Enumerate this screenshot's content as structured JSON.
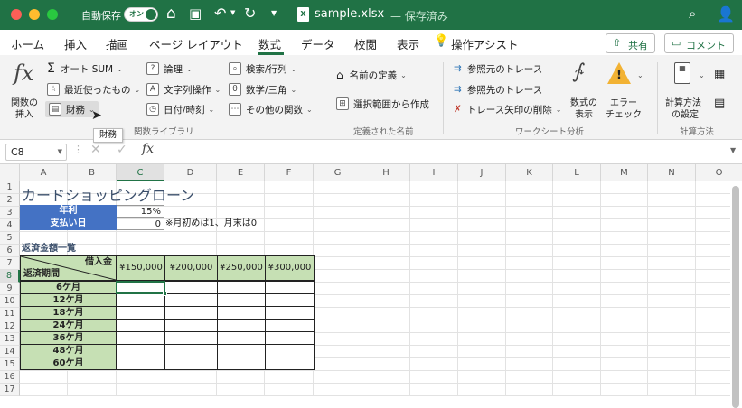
{
  "titlebar": {
    "autosave_label": "自動保存",
    "autosave_toggle": "オン",
    "doc_name": "sample.xlsx",
    "doc_status": "— 保存済み",
    "accent": "#207245"
  },
  "ribbon_tabs": [
    "ホーム",
    "挿入",
    "描画",
    "ページ レイアウト",
    "数式",
    "データ",
    "校閲",
    "表示"
  ],
  "active_tab": "数式",
  "assist_label": "操作アシスト",
  "share_label": "共有",
  "comment_label": "コメント",
  "ribbon": {
    "insert_function": {
      "icon_text": "fx",
      "label1": "関数の",
      "label2": "挿入"
    },
    "col1": [
      "オート SUM",
      "最近使ったもの",
      "財務"
    ],
    "col2": [
      "論理",
      "文字列操作",
      "日付/時刻"
    ],
    "col3": [
      "検索/行列",
      "数学/三角",
      "その他の関数"
    ],
    "group_function_library": "関数ライブラリ",
    "define_name": "名前の定義",
    "create_from_selection": "選択範囲から作成",
    "group_defined_names": "定義された名前",
    "trace_precedents": "参照元のトレース",
    "trace_dependents": "参照先のトレース",
    "remove_arrows": "トレース矢印の削除",
    "show_formulas": {
      "label1": "数式の",
      "label2": "表示"
    },
    "error_check": {
      "label1": "エラー",
      "label2": "チェック"
    },
    "group_formula_auditing": "ワークシート分析",
    "calc_options": {
      "label1": "計算方法",
      "label2": "の設定"
    },
    "group_calculation": "計算方法",
    "tooltip": "財務"
  },
  "formula_bar": {
    "name_box": "C8",
    "fx": "fx",
    "content": ""
  },
  "columns": [
    "A",
    "B",
    "C",
    "D",
    "E",
    "F",
    "G",
    "H",
    "I",
    "J",
    "K",
    "L",
    "M",
    "N",
    "O"
  ],
  "rows": [
    "1",
    "2",
    "3",
    "4",
    "5",
    "6",
    "7",
    "8",
    "9",
    "10",
    "11",
    "12",
    "13",
    "14",
    "15",
    "16",
    "17"
  ],
  "sheet": {
    "title": "カードショッピングローン",
    "rate_label": "年利",
    "rate_value": "15%",
    "payday_label": "支払い日",
    "payday_value": "0",
    "payday_note": "※月初めは1、月末は0",
    "table_title": "返済金額一覧",
    "header_loan": "借入金",
    "header_period": "返済期間",
    "loan_amounts": [
      "¥150,000",
      "¥200,000",
      "¥250,000",
      "¥300,000"
    ],
    "periods": [
      "6ケ月",
      "12ケ月",
      "18ケ月",
      "24ケ月",
      "36ケ月",
      "48ケ月",
      "60ケ月"
    ]
  }
}
